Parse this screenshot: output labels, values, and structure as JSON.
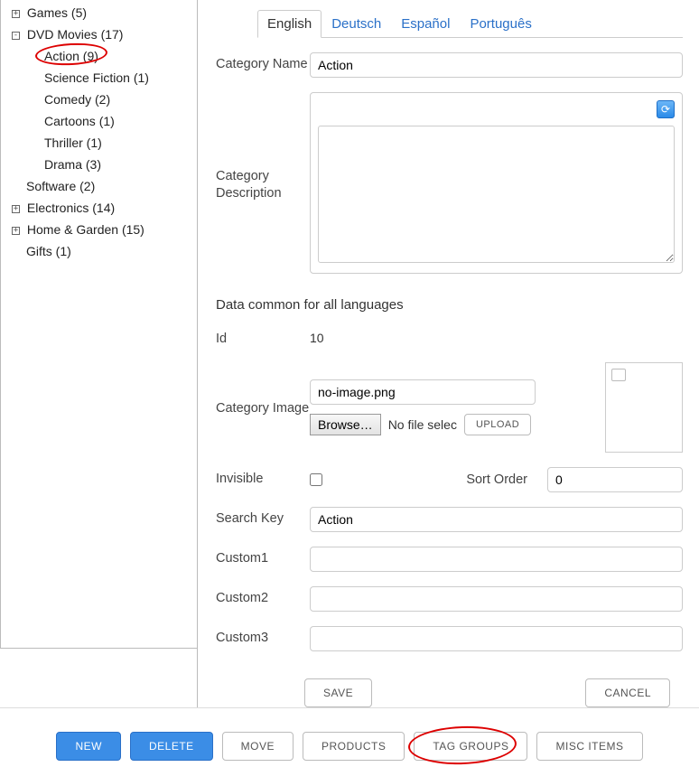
{
  "tree": {
    "games": "Games (5)",
    "dvd": "DVD Movies (17)",
    "dvd_action": "Action (9)",
    "dvd_scifi": "Science Fiction (1)",
    "dvd_comedy": "Comedy (2)",
    "dvd_cartoons": "Cartoons (1)",
    "dvd_thriller": "Thriller (1)",
    "dvd_drama": "Drama (3)",
    "software": "Software (2)",
    "electronics": "Electronics (14)",
    "homegarden": "Home & Garden (15)",
    "gifts": "Gifts (1)"
  },
  "tree_icons": {
    "plus": "+",
    "minus": "-"
  },
  "tabs": {
    "english": "English",
    "deutsch": "Deutsch",
    "espanol": "Español",
    "portugues": "Português"
  },
  "labels": {
    "category_name": "Category Name",
    "category_description": "Category Description",
    "section_common": "Data common for all languages",
    "id": "Id",
    "category_image": "Category Image",
    "invisible": "Invisible",
    "sort_order": "Sort Order",
    "search_key": "Search Key",
    "custom1": "Custom1",
    "custom2": "Custom2",
    "custom3": "Custom3"
  },
  "values": {
    "category_name": "Action",
    "category_description": "",
    "id": "10",
    "image_file": "no-image.png",
    "no_file_text": "No file selec",
    "invisible_checked": false,
    "sort_order": "0",
    "search_key": "Action",
    "custom1": "",
    "custom2": "",
    "custom3": ""
  },
  "buttons": {
    "browse": "Browse…",
    "upload": "UPLOAD",
    "save": "SAVE",
    "cancel": "CANCEL",
    "new": "NEW",
    "delete": "DELETE",
    "move": "MOVE",
    "products": "PRODUCTS",
    "tag_groups": "TAG GROUPS",
    "misc_items": "MISC ITEMS"
  },
  "icons": {
    "editor_toggle": "⟳"
  }
}
